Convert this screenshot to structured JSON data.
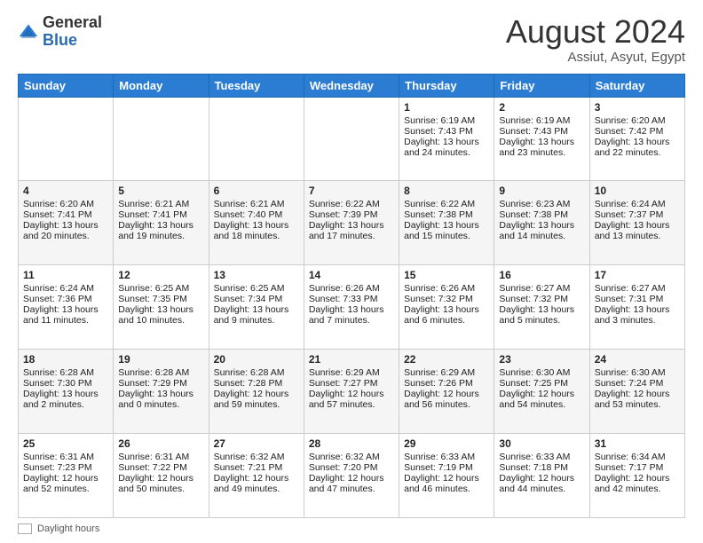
{
  "header": {
    "logo": {
      "line1": "General",
      "line2": "Blue"
    },
    "title": "August 2024",
    "location": "Assiut, Asyut, Egypt"
  },
  "days_of_week": [
    "Sunday",
    "Monday",
    "Tuesday",
    "Wednesday",
    "Thursday",
    "Friday",
    "Saturday"
  ],
  "weeks": [
    {
      "days": [
        {
          "num": "",
          "sunrise": "",
          "sunset": "",
          "daylight": ""
        },
        {
          "num": "",
          "sunrise": "",
          "sunset": "",
          "daylight": ""
        },
        {
          "num": "",
          "sunrise": "",
          "sunset": "",
          "daylight": ""
        },
        {
          "num": "",
          "sunrise": "",
          "sunset": "",
          "daylight": ""
        },
        {
          "num": "1",
          "sunrise": "Sunrise: 6:19 AM",
          "sunset": "Sunset: 7:43 PM",
          "daylight": "Daylight: 13 hours and 24 minutes."
        },
        {
          "num": "2",
          "sunrise": "Sunrise: 6:19 AM",
          "sunset": "Sunset: 7:43 PM",
          "daylight": "Daylight: 13 hours and 23 minutes."
        },
        {
          "num": "3",
          "sunrise": "Sunrise: 6:20 AM",
          "sunset": "Sunset: 7:42 PM",
          "daylight": "Daylight: 13 hours and 22 minutes."
        }
      ]
    },
    {
      "days": [
        {
          "num": "4",
          "sunrise": "Sunrise: 6:20 AM",
          "sunset": "Sunset: 7:41 PM",
          "daylight": "Daylight: 13 hours and 20 minutes."
        },
        {
          "num": "5",
          "sunrise": "Sunrise: 6:21 AM",
          "sunset": "Sunset: 7:41 PM",
          "daylight": "Daylight: 13 hours and 19 minutes."
        },
        {
          "num": "6",
          "sunrise": "Sunrise: 6:21 AM",
          "sunset": "Sunset: 7:40 PM",
          "daylight": "Daylight: 13 hours and 18 minutes."
        },
        {
          "num": "7",
          "sunrise": "Sunrise: 6:22 AM",
          "sunset": "Sunset: 7:39 PM",
          "daylight": "Daylight: 13 hours and 17 minutes."
        },
        {
          "num": "8",
          "sunrise": "Sunrise: 6:22 AM",
          "sunset": "Sunset: 7:38 PM",
          "daylight": "Daylight: 13 hours and 15 minutes."
        },
        {
          "num": "9",
          "sunrise": "Sunrise: 6:23 AM",
          "sunset": "Sunset: 7:38 PM",
          "daylight": "Daylight: 13 hours and 14 minutes."
        },
        {
          "num": "10",
          "sunrise": "Sunrise: 6:24 AM",
          "sunset": "Sunset: 7:37 PM",
          "daylight": "Daylight: 13 hours and 13 minutes."
        }
      ]
    },
    {
      "days": [
        {
          "num": "11",
          "sunrise": "Sunrise: 6:24 AM",
          "sunset": "Sunset: 7:36 PM",
          "daylight": "Daylight: 13 hours and 11 minutes."
        },
        {
          "num": "12",
          "sunrise": "Sunrise: 6:25 AM",
          "sunset": "Sunset: 7:35 PM",
          "daylight": "Daylight: 13 hours and 10 minutes."
        },
        {
          "num": "13",
          "sunrise": "Sunrise: 6:25 AM",
          "sunset": "Sunset: 7:34 PM",
          "daylight": "Daylight: 13 hours and 9 minutes."
        },
        {
          "num": "14",
          "sunrise": "Sunrise: 6:26 AM",
          "sunset": "Sunset: 7:33 PM",
          "daylight": "Daylight: 13 hours and 7 minutes."
        },
        {
          "num": "15",
          "sunrise": "Sunrise: 6:26 AM",
          "sunset": "Sunset: 7:32 PM",
          "daylight": "Daylight: 13 hours and 6 minutes."
        },
        {
          "num": "16",
          "sunrise": "Sunrise: 6:27 AM",
          "sunset": "Sunset: 7:32 PM",
          "daylight": "Daylight: 13 hours and 5 minutes."
        },
        {
          "num": "17",
          "sunrise": "Sunrise: 6:27 AM",
          "sunset": "Sunset: 7:31 PM",
          "daylight": "Daylight: 13 hours and 3 minutes."
        }
      ]
    },
    {
      "days": [
        {
          "num": "18",
          "sunrise": "Sunrise: 6:28 AM",
          "sunset": "Sunset: 7:30 PM",
          "daylight": "Daylight: 13 hours and 2 minutes."
        },
        {
          "num": "19",
          "sunrise": "Sunrise: 6:28 AM",
          "sunset": "Sunset: 7:29 PM",
          "daylight": "Daylight: 13 hours and 0 minutes."
        },
        {
          "num": "20",
          "sunrise": "Sunrise: 6:28 AM",
          "sunset": "Sunset: 7:28 PM",
          "daylight": "Daylight: 12 hours and 59 minutes."
        },
        {
          "num": "21",
          "sunrise": "Sunrise: 6:29 AM",
          "sunset": "Sunset: 7:27 PM",
          "daylight": "Daylight: 12 hours and 57 minutes."
        },
        {
          "num": "22",
          "sunrise": "Sunrise: 6:29 AM",
          "sunset": "Sunset: 7:26 PM",
          "daylight": "Daylight: 12 hours and 56 minutes."
        },
        {
          "num": "23",
          "sunrise": "Sunrise: 6:30 AM",
          "sunset": "Sunset: 7:25 PM",
          "daylight": "Daylight: 12 hours and 54 minutes."
        },
        {
          "num": "24",
          "sunrise": "Sunrise: 6:30 AM",
          "sunset": "Sunset: 7:24 PM",
          "daylight": "Daylight: 12 hours and 53 minutes."
        }
      ]
    },
    {
      "days": [
        {
          "num": "25",
          "sunrise": "Sunrise: 6:31 AM",
          "sunset": "Sunset: 7:23 PM",
          "daylight": "Daylight: 12 hours and 52 minutes."
        },
        {
          "num": "26",
          "sunrise": "Sunrise: 6:31 AM",
          "sunset": "Sunset: 7:22 PM",
          "daylight": "Daylight: 12 hours and 50 minutes."
        },
        {
          "num": "27",
          "sunrise": "Sunrise: 6:32 AM",
          "sunset": "Sunset: 7:21 PM",
          "daylight": "Daylight: 12 hours and 49 minutes."
        },
        {
          "num": "28",
          "sunrise": "Sunrise: 6:32 AM",
          "sunset": "Sunset: 7:20 PM",
          "daylight": "Daylight: 12 hours and 47 minutes."
        },
        {
          "num": "29",
          "sunrise": "Sunrise: 6:33 AM",
          "sunset": "Sunset: 7:19 PM",
          "daylight": "Daylight: 12 hours and 46 minutes."
        },
        {
          "num": "30",
          "sunrise": "Sunrise: 6:33 AM",
          "sunset": "Sunset: 7:18 PM",
          "daylight": "Daylight: 12 hours and 44 minutes."
        },
        {
          "num": "31",
          "sunrise": "Sunrise: 6:34 AM",
          "sunset": "Sunset: 7:17 PM",
          "daylight": "Daylight: 12 hours and 42 minutes."
        }
      ]
    }
  ],
  "footer": {
    "swatch_label": "Daylight hours"
  }
}
